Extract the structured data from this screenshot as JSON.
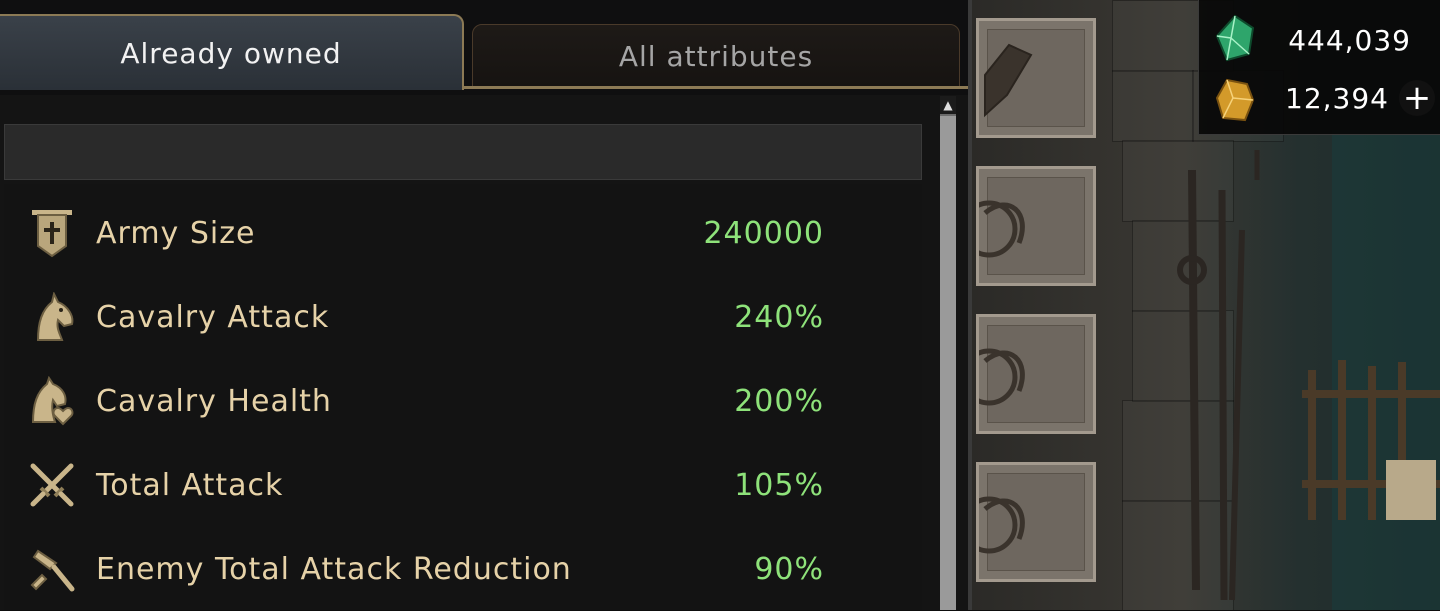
{
  "tabs": [
    {
      "label": "Already owned",
      "active": true
    },
    {
      "label": "All attributes",
      "active": false
    }
  ],
  "attributes": [
    {
      "icon": "banner-cross-icon",
      "label": "Army Size",
      "value": "240000"
    },
    {
      "icon": "horse-head-icon",
      "label": "Cavalry Attack",
      "value": "240%"
    },
    {
      "icon": "horse-heart-icon",
      "label": "Cavalry Health",
      "value": "200%"
    },
    {
      "icon": "crossed-swords-icon",
      "label": "Total Attack",
      "value": "105%"
    },
    {
      "icon": "broken-sword-icon",
      "label": "Enemy Total Attack Reduction",
      "value": "90%"
    }
  ],
  "currency": {
    "gems": {
      "icon": "green-gem-icon",
      "value": "444,039"
    },
    "gold": {
      "icon": "gold-ore-icon",
      "value": "12,394",
      "add": "+"
    }
  },
  "colors": {
    "label": "#e6d2a8",
    "value": "#8ee27a",
    "tab_border": "#8c7a55"
  }
}
